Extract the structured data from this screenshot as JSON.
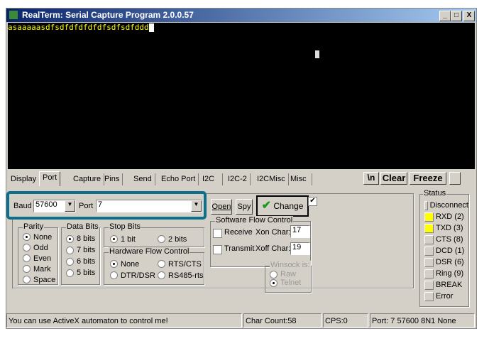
{
  "window": {
    "title": "RealTerm: Serial Capture Program 2.0.0.57",
    "min": "_",
    "max": "□",
    "close": "X"
  },
  "terminal": {
    "text": "asaaaaasdfsdfdfdfdfdfsdfsdfddd"
  },
  "tabs": [
    "Display",
    "Port",
    "Capture",
    "Pins",
    "Send",
    "Echo Port",
    "I2C",
    "I2C-2",
    "I2CMisc",
    "Misc"
  ],
  "active_tab": "Port",
  "toolbar": {
    "newline": "\\n",
    "clear": "Clear",
    "freeze": "Freeze"
  },
  "port": {
    "baud_label": "Baud",
    "baud_value": "57600",
    "port_label": "Port",
    "port_value": "7",
    "open": "Open",
    "spy": "Spy",
    "change": "Change",
    "change_checked": true
  },
  "parity": {
    "label": "Parity",
    "options": [
      "None",
      "Odd",
      "Even",
      "Mark",
      "Space"
    ],
    "selected": "None"
  },
  "data_bits": {
    "label": "Data Bits",
    "options": [
      "8 bits",
      "7 bits",
      "6 bits",
      "5 bits"
    ],
    "selected": "8 bits"
  },
  "stop_bits": {
    "label": "Stop Bits",
    "options": [
      "1 bit",
      "2 bits"
    ],
    "selected": "1 bit"
  },
  "hw_flow": {
    "label": "Hardware Flow Control",
    "options": [
      "None",
      "RTS/CTS",
      "DTR/DSR",
      "RS485-rts"
    ],
    "selected": "None"
  },
  "sw_flow": {
    "label": "Software Flow Control",
    "receive": "Receive",
    "transmit": "Transmit",
    "xon_label": "Xon Char:",
    "xon": "17",
    "xoff_label": "Xoff Char:",
    "xoff": "19"
  },
  "winsock": {
    "label": "Winsock is:",
    "options": [
      "Raw",
      "Telnet"
    ],
    "selected": "Telnet"
  },
  "status": {
    "label": "Status",
    "items": [
      {
        "name": "Disconnect",
        "on": false
      },
      {
        "name": "RXD (2)",
        "on": true
      },
      {
        "name": "TXD (3)",
        "on": true
      },
      {
        "name": "CTS (8)",
        "on": false
      },
      {
        "name": "DCD (1)",
        "on": false
      },
      {
        "name": "DSR (6)",
        "on": false
      },
      {
        "name": "Ring (9)",
        "on": false
      },
      {
        "name": "BREAK",
        "on": false
      },
      {
        "name": "Error",
        "on": false
      }
    ],
    "on_color": "#ffff00"
  },
  "statusbar": {
    "message": "You can use ActiveX automaton to control me!",
    "char_count": "Char Count:58",
    "cps": "CPS:0",
    "port": "Port: 7 57600 8N1 None"
  },
  "highlight_color": "#0e6f8a"
}
